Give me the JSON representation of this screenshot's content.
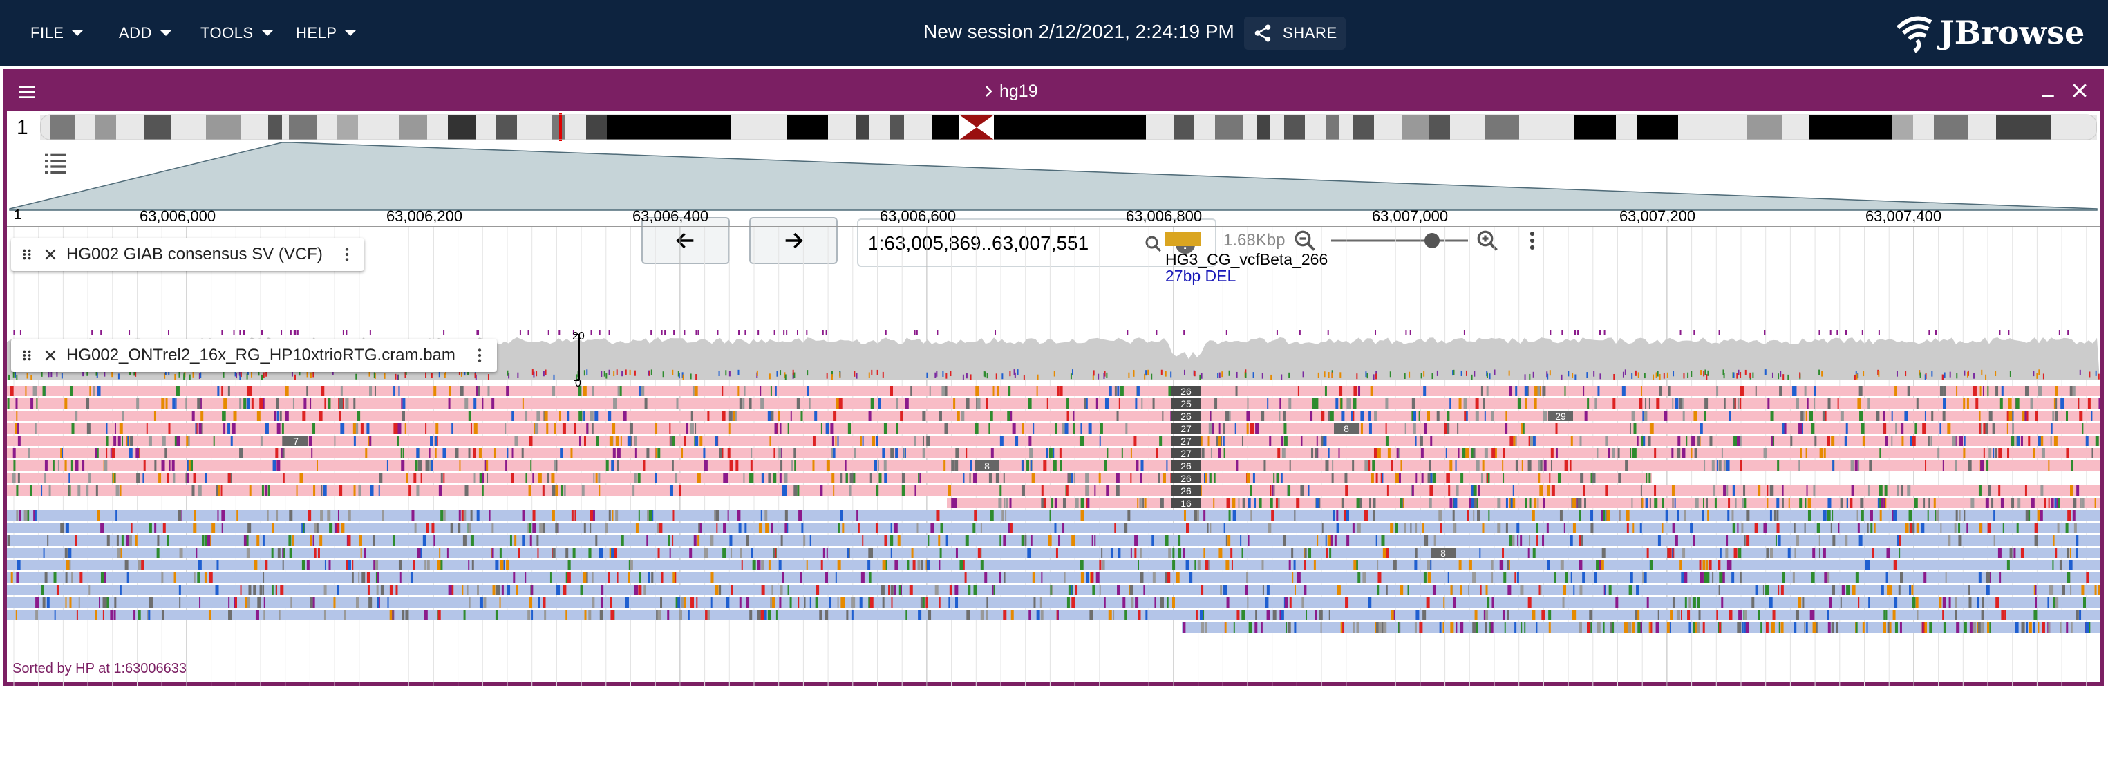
{
  "app": {
    "menus": [
      {
        "label": "FILE"
      },
      {
        "label": "ADD"
      },
      {
        "label": "TOOLS"
      },
      {
        "label": "HELP"
      }
    ],
    "session_title": "New session 2/12/2021, 2:24:19 PM",
    "share_label": "SHARE",
    "logo_text": "JBrowse"
  },
  "view": {
    "assembly": "hg19",
    "chromosome": "1",
    "location": "1:63,005,869..63,007,551",
    "bp_per_view": "1.68Kbp",
    "ruler": {
      "left_label": "1",
      "ticks": [
        "63,006,000",
        "63,006,200",
        "63,006,400",
        "63,006,600",
        "63,006,800",
        "63,007,000",
        "63,007,200",
        "63,007,400"
      ]
    },
    "tracks": [
      {
        "name": "HG002 GIAB consensus SV (VCF)"
      },
      {
        "name": "HG002_ONTrel2_16x_RG_HP10xtrioRTG.cram.bam"
      }
    ],
    "feature": {
      "name": "HG3_CG_vcfBeta_266",
      "description": "27bp DEL"
    },
    "coverage": {
      "max_label": "20",
      "min_label": "0"
    },
    "deletion_labels": [
      "26",
      "25",
      "26",
      "27",
      "27",
      "27",
      "26",
      "26",
      "26",
      "16"
    ],
    "misc_labels": [
      "29",
      "8",
      "8",
      "7",
      "8"
    ],
    "sort_status": "Sorted by HP at 1:63006633"
  },
  "colors": {
    "appbar": "#0d233f",
    "view_accent": "#7b1f63",
    "read_hp1": "#f8bcc6",
    "read_hp2": "#b4c5e8",
    "coverage": "#cccccc",
    "feature": "#daa520"
  }
}
